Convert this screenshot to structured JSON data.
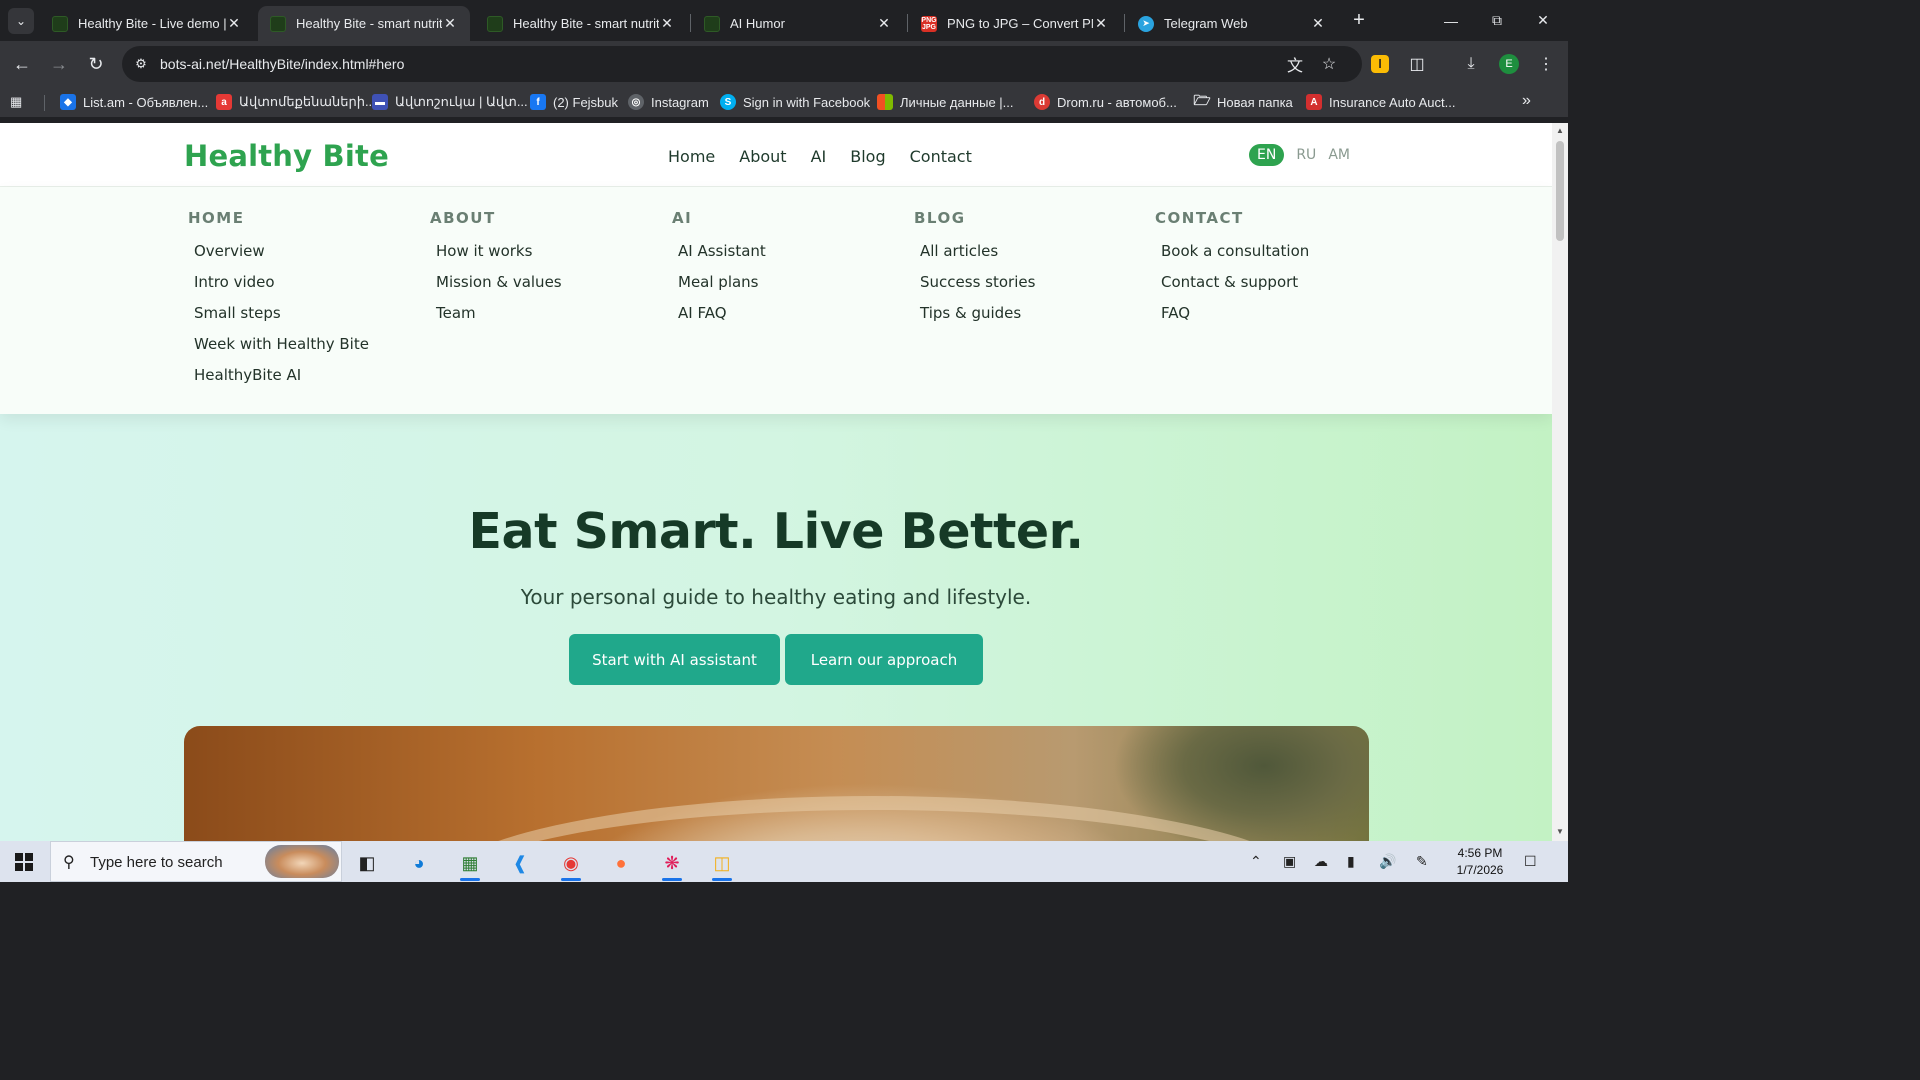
{
  "browser": {
    "tabs": [
      {
        "title": "Healthy Bite - Live demo | AI",
        "icon": "healthybite-favicon",
        "active": false
      },
      {
        "title": "Healthy Bite - smart nutrition",
        "icon": "healthybite-favicon",
        "active": true
      },
      {
        "title": "Healthy Bite - smart nutrition",
        "icon": "healthybite-favicon",
        "active": false
      },
      {
        "title": "AI Humor",
        "icon": "healthybite-favicon",
        "active": false
      },
      {
        "title": "PNG to JPG – Convert PNG",
        "icon": "png-jpg-favicon",
        "active": false
      },
      {
        "title": "Telegram Web",
        "icon": "telegram-favicon",
        "active": false
      }
    ],
    "url": "bots-ai.net/HealthyBite/index.html#hero",
    "profile_initial": "E",
    "bookmarks": [
      {
        "label": "List.am - Объявлен...",
        "icon": "listam-icon",
        "color": "#1a73e8"
      },
      {
        "label": "Ավտոմեքենաների...",
        "icon": "auto-am-icon",
        "color": "#e53935"
      },
      {
        "label": "Ավտոշուկա | Ավտ...",
        "icon": "car-icon",
        "color": "#3f51b5"
      },
      {
        "label": "(2) Fejsbuk",
        "icon": "facebook-icon",
        "color": "#1877f2"
      },
      {
        "label": "Instagram",
        "icon": "globe-icon",
        "color": "#5f6368"
      },
      {
        "label": "Sign in with Facebook",
        "icon": "skype-icon",
        "color": "#00aff0"
      },
      {
        "label": "Личные данные |...",
        "icon": "microsoft-icon",
        "color": "#f25022"
      },
      {
        "label": "Drom.ru - автомоб...",
        "icon": "drom-icon",
        "color": "#db3a34"
      },
      {
        "label": "Новая папка",
        "icon": "folder-icon",
        "color": "#e8eaed"
      },
      {
        "label": "Insurance Auto Auct...",
        "icon": "iaa-icon",
        "color": "#d32f2f"
      }
    ]
  },
  "site": {
    "logo": "Healthy Bite",
    "nav": [
      "Home",
      "About",
      "AI",
      "Blog",
      "Contact"
    ],
    "languages": [
      {
        "code": "EN",
        "active": true
      },
      {
        "code": "RU",
        "active": false
      },
      {
        "code": "AM",
        "active": false
      }
    ],
    "mega_menu": [
      {
        "heading": "HOME",
        "items": [
          "Overview",
          "Intro video",
          "Small steps",
          "Week with Healthy Bite",
          "HealthyBite AI"
        ]
      },
      {
        "heading": "ABOUT",
        "items": [
          "How it works",
          "Mission & values",
          "Team"
        ]
      },
      {
        "heading": "AI",
        "items": [
          "AI Assistant",
          "Meal plans",
          "AI FAQ"
        ]
      },
      {
        "heading": "BLOG",
        "items": [
          "All articles",
          "Success stories",
          "Tips & guides"
        ]
      },
      {
        "heading": "CONTACT",
        "items": [
          "Book a consultation",
          "Contact & support",
          "FAQ"
        ]
      }
    ],
    "hero": {
      "title": "Eat Smart. Live Better.",
      "subtitle": "Your personal guide to healthy eating and lifestyle.",
      "primary_button": "Start with AI assistant",
      "secondary_button": "Learn our approach"
    },
    "colors": {
      "brand": "#2ea34f",
      "button": "#20a88b",
      "heading": "#163a27"
    }
  },
  "taskbar": {
    "search_placeholder": "Type here to search",
    "time": "4:56 PM",
    "date": "1/7/2026"
  }
}
